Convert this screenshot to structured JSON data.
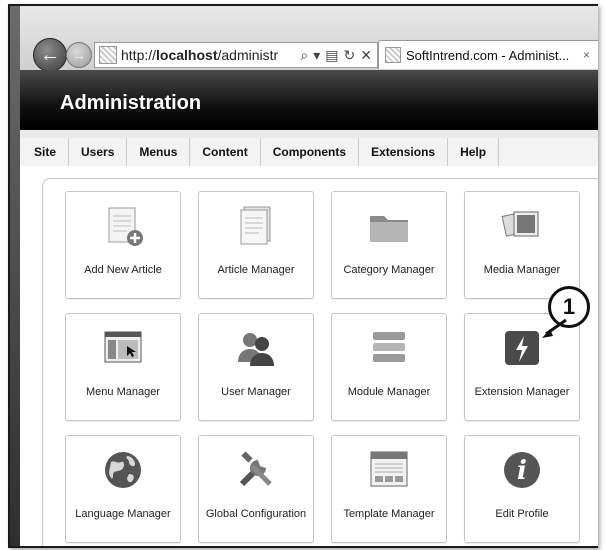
{
  "browser": {
    "back_icon": "back-arrow-icon",
    "forward_icon": "forward-arrow-icon",
    "url_prefix": "http://",
    "url_host": "localhost",
    "url_rest": "/administr",
    "tools": [
      "⌕",
      "▾",
      "▤",
      "↻",
      "✕"
    ],
    "tab_title": "SoftIntrend.com - Administ...",
    "tab_close": "×"
  },
  "header": {
    "title": "Administration"
  },
  "menu": {
    "items": [
      "Site",
      "Users",
      "Menus",
      "Content",
      "Components",
      "Extensions",
      "Help"
    ]
  },
  "tiles": [
    {
      "label": "Add New Article",
      "icon": "add-article-icon"
    },
    {
      "label": "Article Manager",
      "icon": "article-icon"
    },
    {
      "label": "Category Manager",
      "icon": "folder-icon"
    },
    {
      "label": "Media Manager",
      "icon": "media-icon"
    },
    {
      "label": "Menu Manager",
      "icon": "menu-icon"
    },
    {
      "label": "User Manager",
      "icon": "users-icon"
    },
    {
      "label": "Module Manager",
      "icon": "module-icon"
    },
    {
      "label": "Extension Manager",
      "icon": "extension-icon"
    },
    {
      "label": "Language Manager",
      "icon": "globe-icon"
    },
    {
      "label": "Global Configuration",
      "icon": "tools-icon"
    },
    {
      "label": "Template Manager",
      "icon": "template-icon"
    },
    {
      "label": "Edit Profile",
      "icon": "info-icon"
    }
  ],
  "callout": {
    "number": "1"
  }
}
